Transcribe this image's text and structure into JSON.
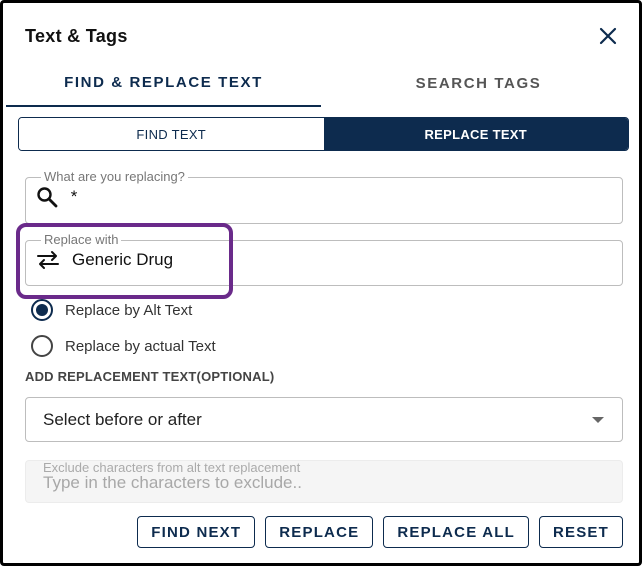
{
  "dialog": {
    "title": "Text & Tags",
    "close_icon": "close-icon"
  },
  "main_tabs": [
    {
      "label": "FIND & REPLACE TEXT",
      "active": true
    },
    {
      "label": "SEARCH TAGS",
      "active": false
    }
  ],
  "mode_tabs": [
    {
      "label": "FIND TEXT",
      "active": false
    },
    {
      "label": "REPLACE TEXT",
      "active": true
    }
  ],
  "search_field": {
    "label": "What are you replacing?",
    "value": "*",
    "icon": "search-icon"
  },
  "replace_field": {
    "label": "Replace with",
    "value": "Generic Drug",
    "icon": "swap-icon"
  },
  "replace_options": [
    {
      "label": "Replace by Alt Text",
      "checked": true
    },
    {
      "label": "Replace by actual Text",
      "checked": false
    }
  ],
  "replacement_section": {
    "label": "ADD REPLACEMENT TEXT(OPTIONAL)",
    "select_value": "Select before or after"
  },
  "exclude_field": {
    "label": "Exclude characters from alt text replacement",
    "placeholder": "Type in the characters to exclude.."
  },
  "actions": {
    "find_next": "FIND NEXT",
    "replace": "REPLACE",
    "replace_all": "REPLACE ALL",
    "reset": "RESET"
  },
  "colors": {
    "primary": "#0d2b4e",
    "highlight": "#6a2a8a"
  }
}
